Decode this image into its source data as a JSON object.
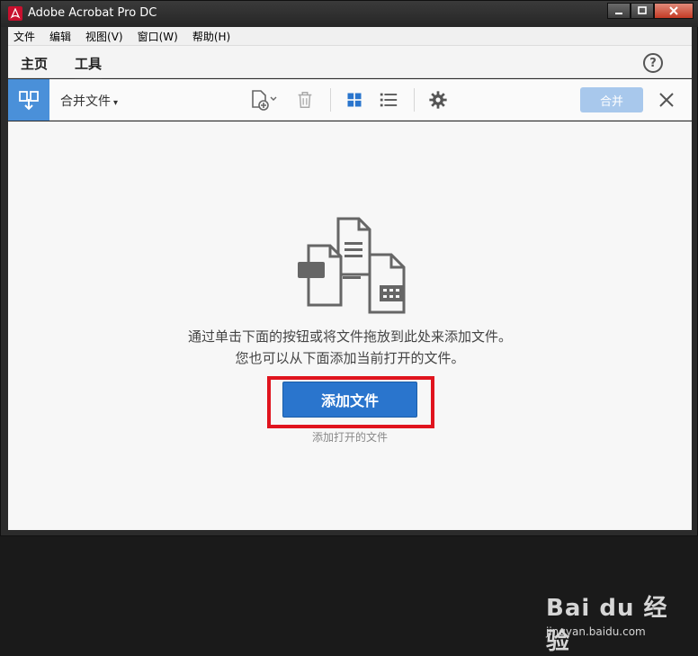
{
  "window": {
    "title": "Adobe Acrobat Pro DC"
  },
  "menu": [
    "文件",
    "编辑",
    "视图(V)",
    "窗口(W)",
    "帮助(H)"
  ],
  "tabs": {
    "home": "主页",
    "tools": "工具"
  },
  "help": {
    "glyph": "?"
  },
  "toolbar": {
    "tool_name": "合并文件",
    "caret": "▾",
    "merge_label": "合并"
  },
  "content": {
    "message_line1": "通过单击下面的按钮或将文件拖放到此处来添加文件。",
    "message_line2": "您也可以从下面添加当前打开的文件。",
    "add_files_label": "添加文件",
    "add_open_files_label": "添加打开的文件"
  },
  "watermark": {
    "brand": "Bai du 经验",
    "url": "jingyan.baidu.com"
  },
  "colors": {
    "accent": "#2a75cd",
    "tool_badge": "#4a90d9",
    "merge_disabled": "#a8c8ec",
    "highlight": "#e0141e"
  }
}
